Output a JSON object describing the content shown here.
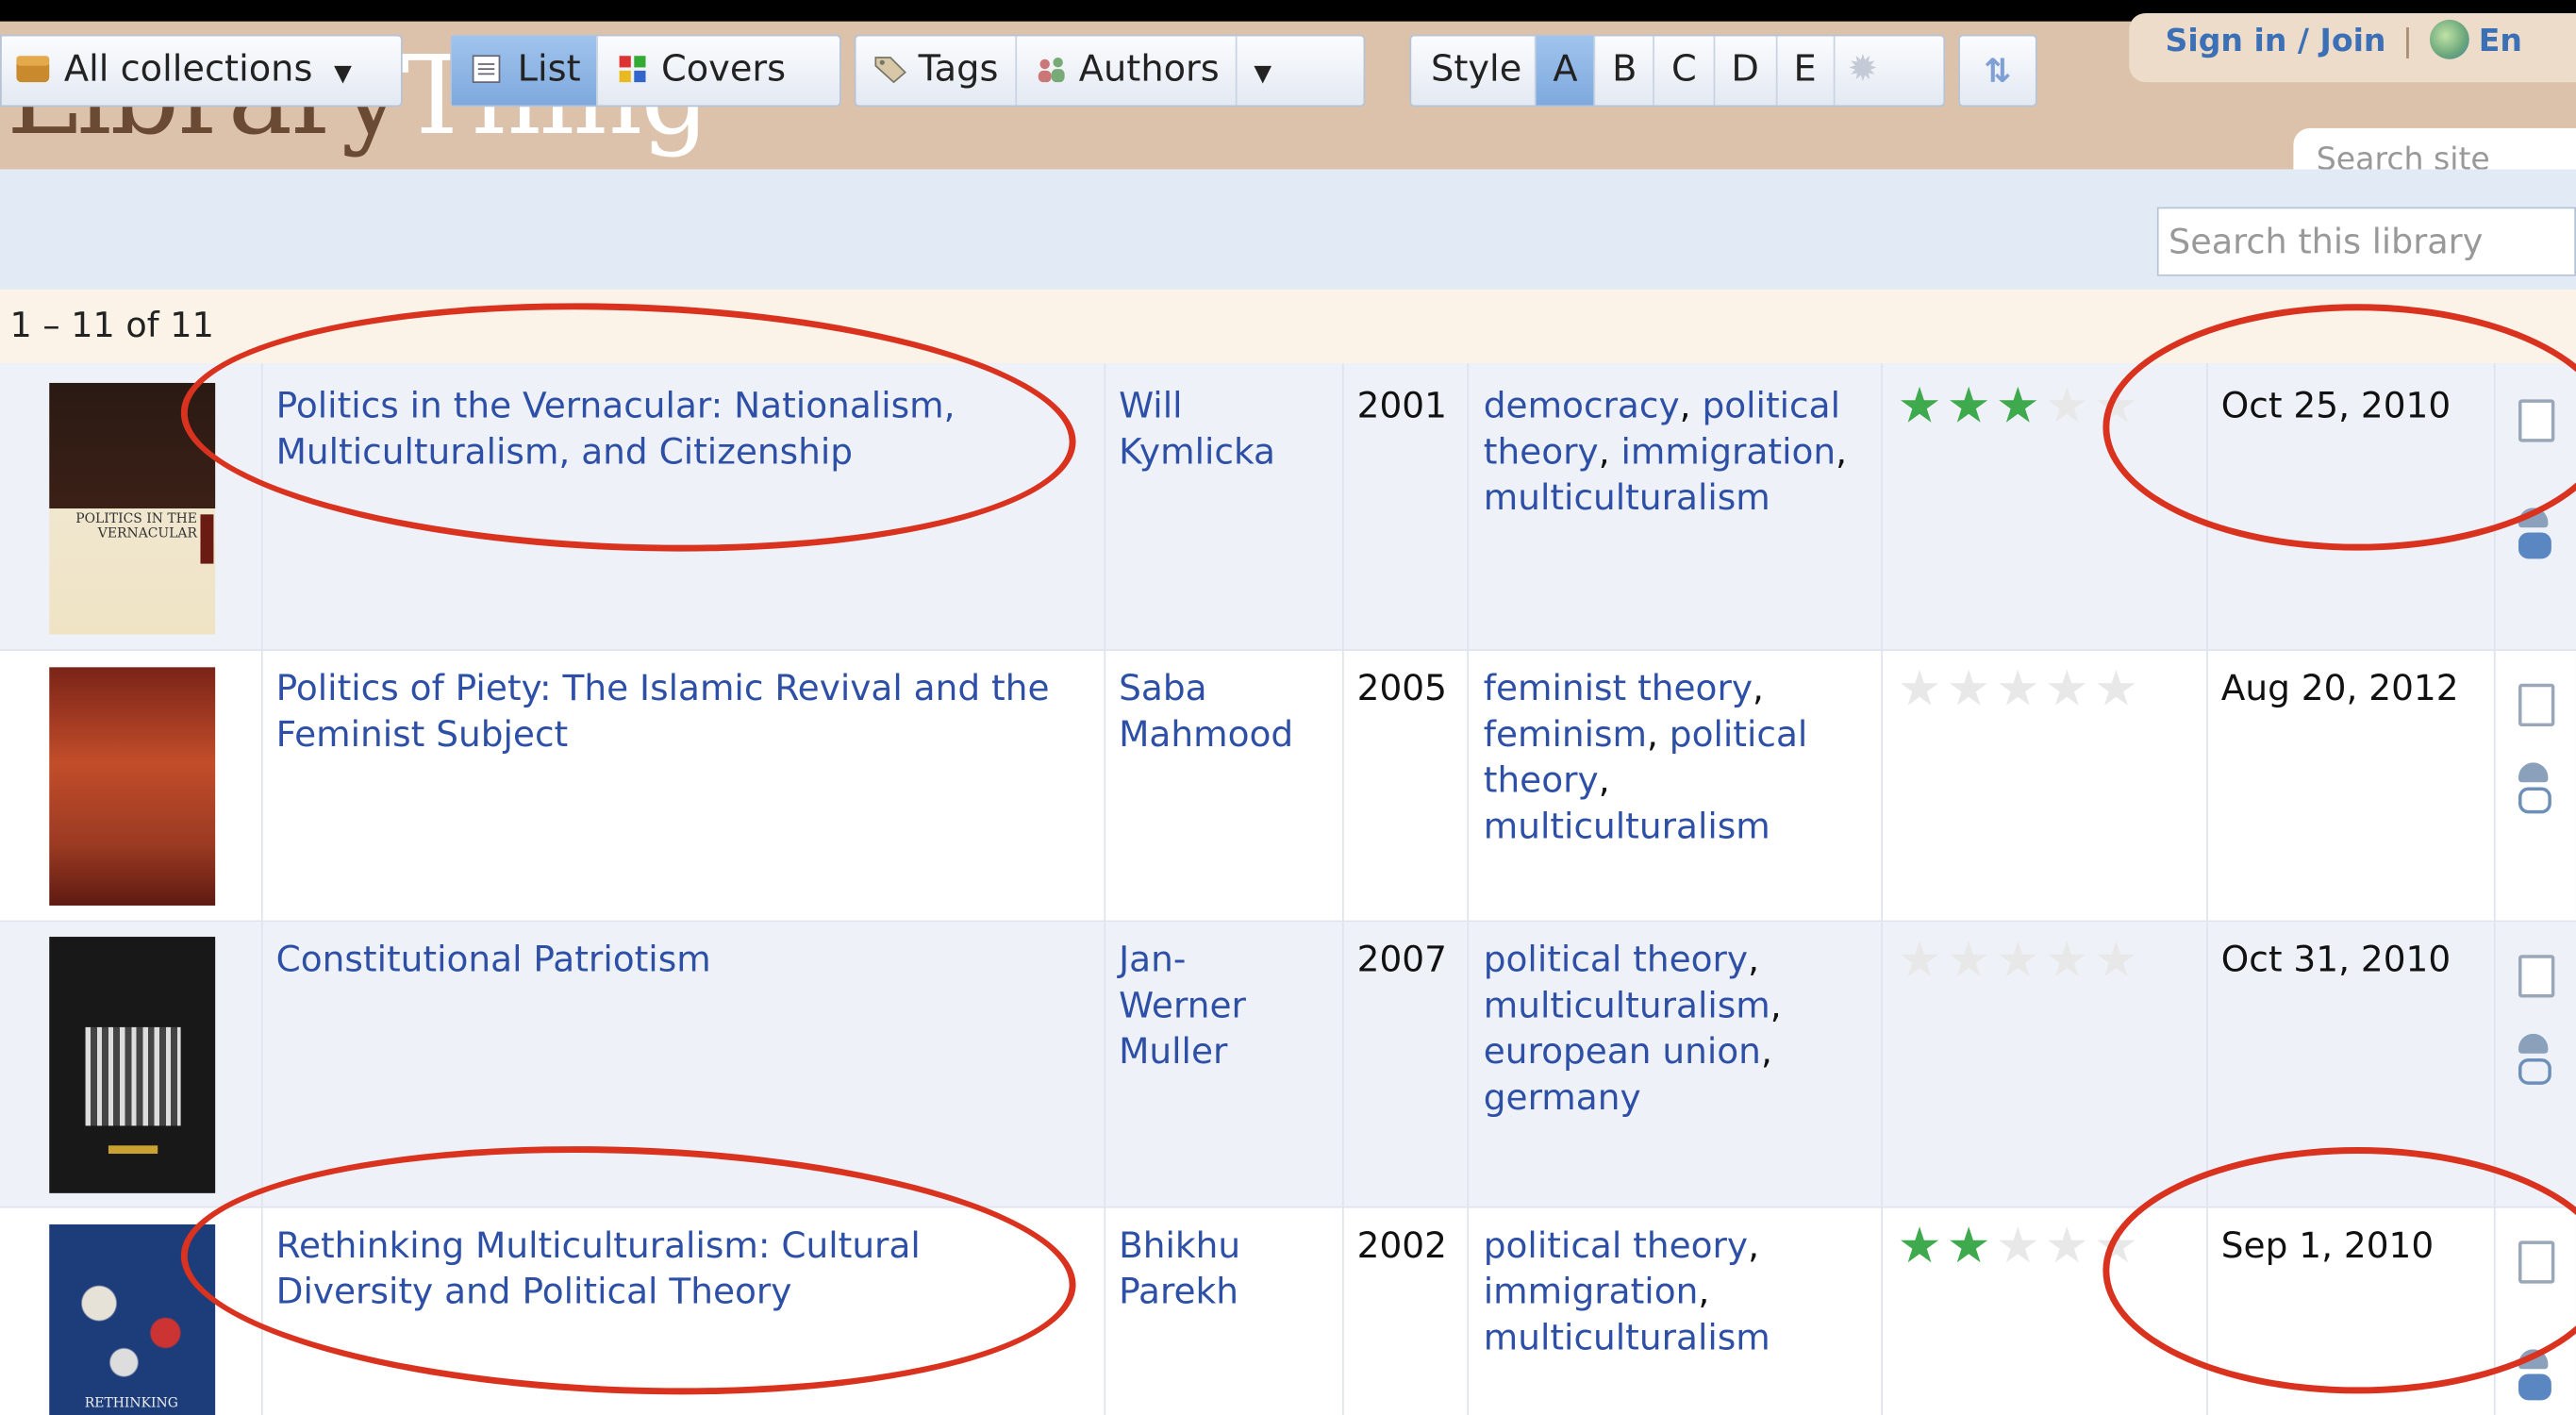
{
  "header": {
    "logo_part1": "Library",
    "logo_part2": "Thing",
    "signin_label": "Sign in / Join",
    "language_label": "En",
    "search_site_placeholder": "Search site"
  },
  "toolbar": {
    "collections_label": "All collections",
    "list_label": "List",
    "covers_label": "Covers",
    "tags_label": "Tags",
    "authors_label": "Authors",
    "style_label": "Style",
    "style_options": [
      "A",
      "B",
      "C",
      "D",
      "E"
    ],
    "search_library_placeholder": "Search this library"
  },
  "count_text": "1 – 11 of 11",
  "books": [
    {
      "title": "Politics in the Vernacular: Nationalism, Multiculturalism, and Citizenship",
      "author": "Will Kymlicka",
      "year": "2001",
      "tags": [
        "democracy",
        "political theory",
        "immigration",
        "multiculturalism"
      ],
      "rating": 3,
      "date": "Oct 25, 2010",
      "cover_text": "POLITICS IN THE VERNACULAR"
    },
    {
      "title": "Politics of Piety: The Islamic Revival and the Feminist Subject",
      "author": "Saba Mahmood",
      "year": "2005",
      "tags": [
        "feminist theory",
        "feminism",
        "political theory",
        "multiculturalism"
      ],
      "rating": 0,
      "date": "Aug 20, 2012"
    },
    {
      "title": "Constitutional Patriotism",
      "author": "Jan-Werner Muller",
      "year": "2007",
      "tags": [
        "political theory",
        "multiculturalism",
        "european union",
        "germany"
      ],
      "rating": 0,
      "date": "Oct 31, 2010"
    },
    {
      "title": "Rethinking Multiculturalism: Cultural Diversity and Political Theory",
      "author": "Bhikhu Parekh",
      "year": "2002",
      "tags": [
        "political theory",
        "immigration",
        "multiculturalism"
      ],
      "rating": 2,
      "date": "Sep 1, 2010",
      "cover_text": "RETHINKING"
    }
  ],
  "colors": {
    "header_bg": "#dcc2aa",
    "link_blue": "#2d4fa6",
    "star_green": "#3fa94e",
    "annotation_red": "#d9321f"
  }
}
